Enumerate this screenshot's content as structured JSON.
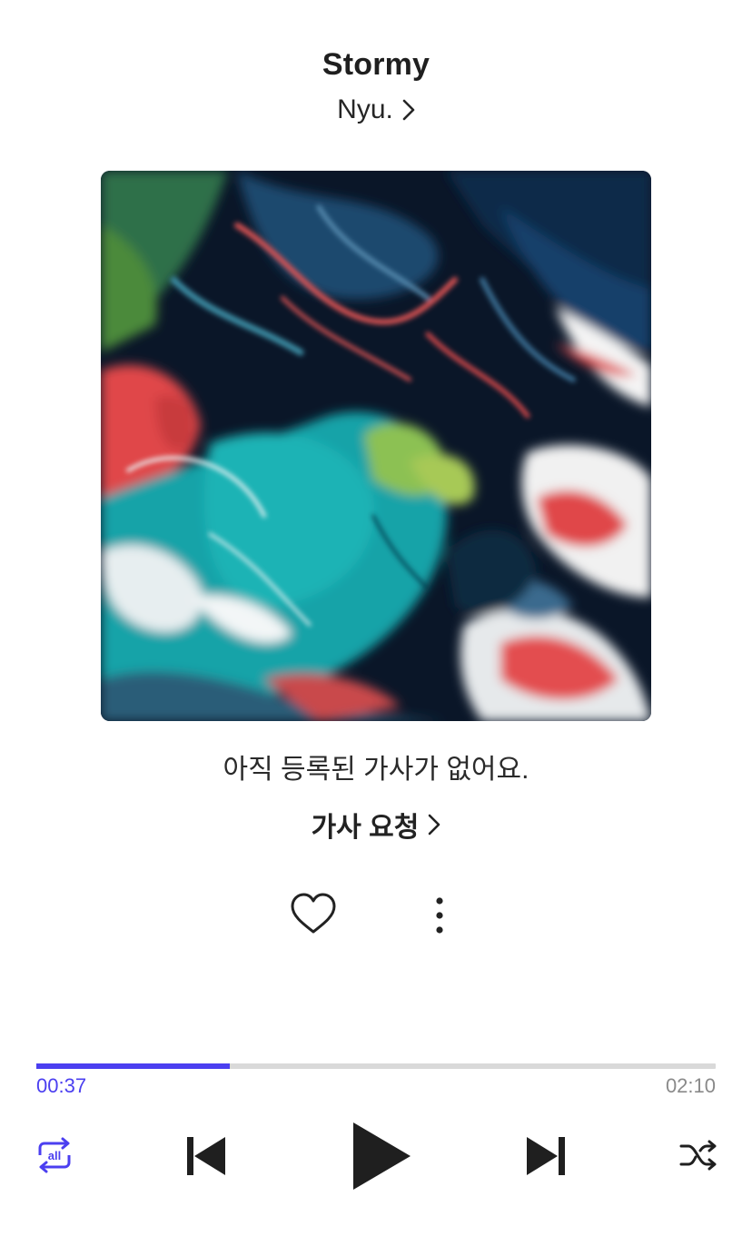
{
  "track": {
    "title": "Stormy",
    "artist": "Nyu."
  },
  "lyrics": {
    "empty_message": "아직 등록된 가사가 없어요.",
    "request_label": "가사 요청"
  },
  "playback": {
    "current_time": "00:37",
    "total_time": "02:10",
    "progress_fraction": 0.285,
    "repeat_mode_label": "all"
  },
  "icons": {
    "artist_chevron": "chevron-right-icon",
    "like": "heart-outline-icon",
    "more": "more-vertical-icon",
    "repeat": "repeat-all-icon",
    "previous": "skip-previous-icon",
    "play": "play-icon",
    "next": "skip-next-icon",
    "shuffle": "shuffle-icon"
  },
  "colors": {
    "accent": "#4b3ff0",
    "track": "#d9d9d9",
    "text": "#222222",
    "muted": "#8a8a8a"
  }
}
